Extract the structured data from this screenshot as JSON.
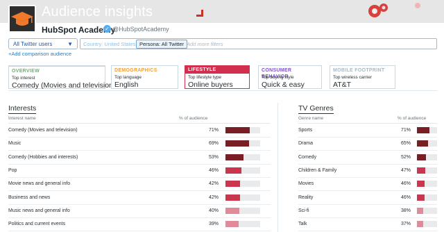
{
  "header": {
    "title": "Audience insights",
    "account_name": "HubSpot Academy",
    "account_handle": "@HubSpotAcademy"
  },
  "controls": {
    "audience_select": "All Twitter users",
    "filters": {
      "country": "Country: United States",
      "persona": "Persona: All Twitter",
      "add_placeholder": "Add more filters"
    },
    "add_comparison": "+Add comparison audience"
  },
  "tabs": [
    {
      "title": "OVERVIEW",
      "sub": "Top interest",
      "value": "Comedy (Movies and television)"
    },
    {
      "title": "DEMOGRAPHICS",
      "sub": "Top language",
      "value": "English"
    },
    {
      "title": "LIFESTYLE",
      "sub": "Top lifestyle type",
      "value": "Online buyers"
    },
    {
      "title": "CONSUMER BEHAVIOR",
      "sub": "Top buying style",
      "value": "Quick & easy"
    },
    {
      "title": "MOBILE FOOTPRINT",
      "sub": "Top wireless carrier",
      "value": "AT&T"
    }
  ],
  "interests": {
    "title": "Interests",
    "col_name": "Interest name",
    "col_pct": "% of audience",
    "rows": [
      {
        "name": "Comedy (Movies and television)",
        "pct": "71%",
        "value": 71
      },
      {
        "name": "Music",
        "pct": "69%",
        "value": 69
      },
      {
        "name": "Comedy (Hobbies and interests)",
        "pct": "53%",
        "value": 53
      },
      {
        "name": "Pop",
        "pct": "46%",
        "value": 46
      },
      {
        "name": "Movie news and general info",
        "pct": "42%",
        "value": 42
      },
      {
        "name": "Business and news",
        "pct": "42%",
        "value": 42
      },
      {
        "name": "Music news and general info",
        "pct": "40%",
        "value": 40
      },
      {
        "name": "Politics and current events",
        "pct": "39%",
        "value": 39
      }
    ]
  },
  "tv_genres": {
    "title": "TV Genres",
    "col_name": "Genre name",
    "col_pct": "% of audience",
    "rows": [
      {
        "name": "Sports",
        "pct": "71%",
        "value": 71
      },
      {
        "name": "Drama",
        "pct": "65%",
        "value": 65
      },
      {
        "name": "Comedy",
        "pct": "52%",
        "value": 52
      },
      {
        "name": "Children & Family",
        "pct": "47%",
        "value": 47
      },
      {
        "name": "Movies",
        "pct": "46%",
        "value": 46
      },
      {
        "name": "Reality",
        "pct": "46%",
        "value": 46
      },
      {
        "name": "Sci-fi",
        "pct": "38%",
        "value": 38
      },
      {
        "name": "Talk",
        "pct": "37%",
        "value": 37
      }
    ]
  },
  "colors": {
    "bar_dark": "#7a1e26",
    "bar_mid": "#c9374f",
    "bar_light": "#e08a9a",
    "track": "#e8eaec",
    "link": "#2b7bb9"
  }
}
